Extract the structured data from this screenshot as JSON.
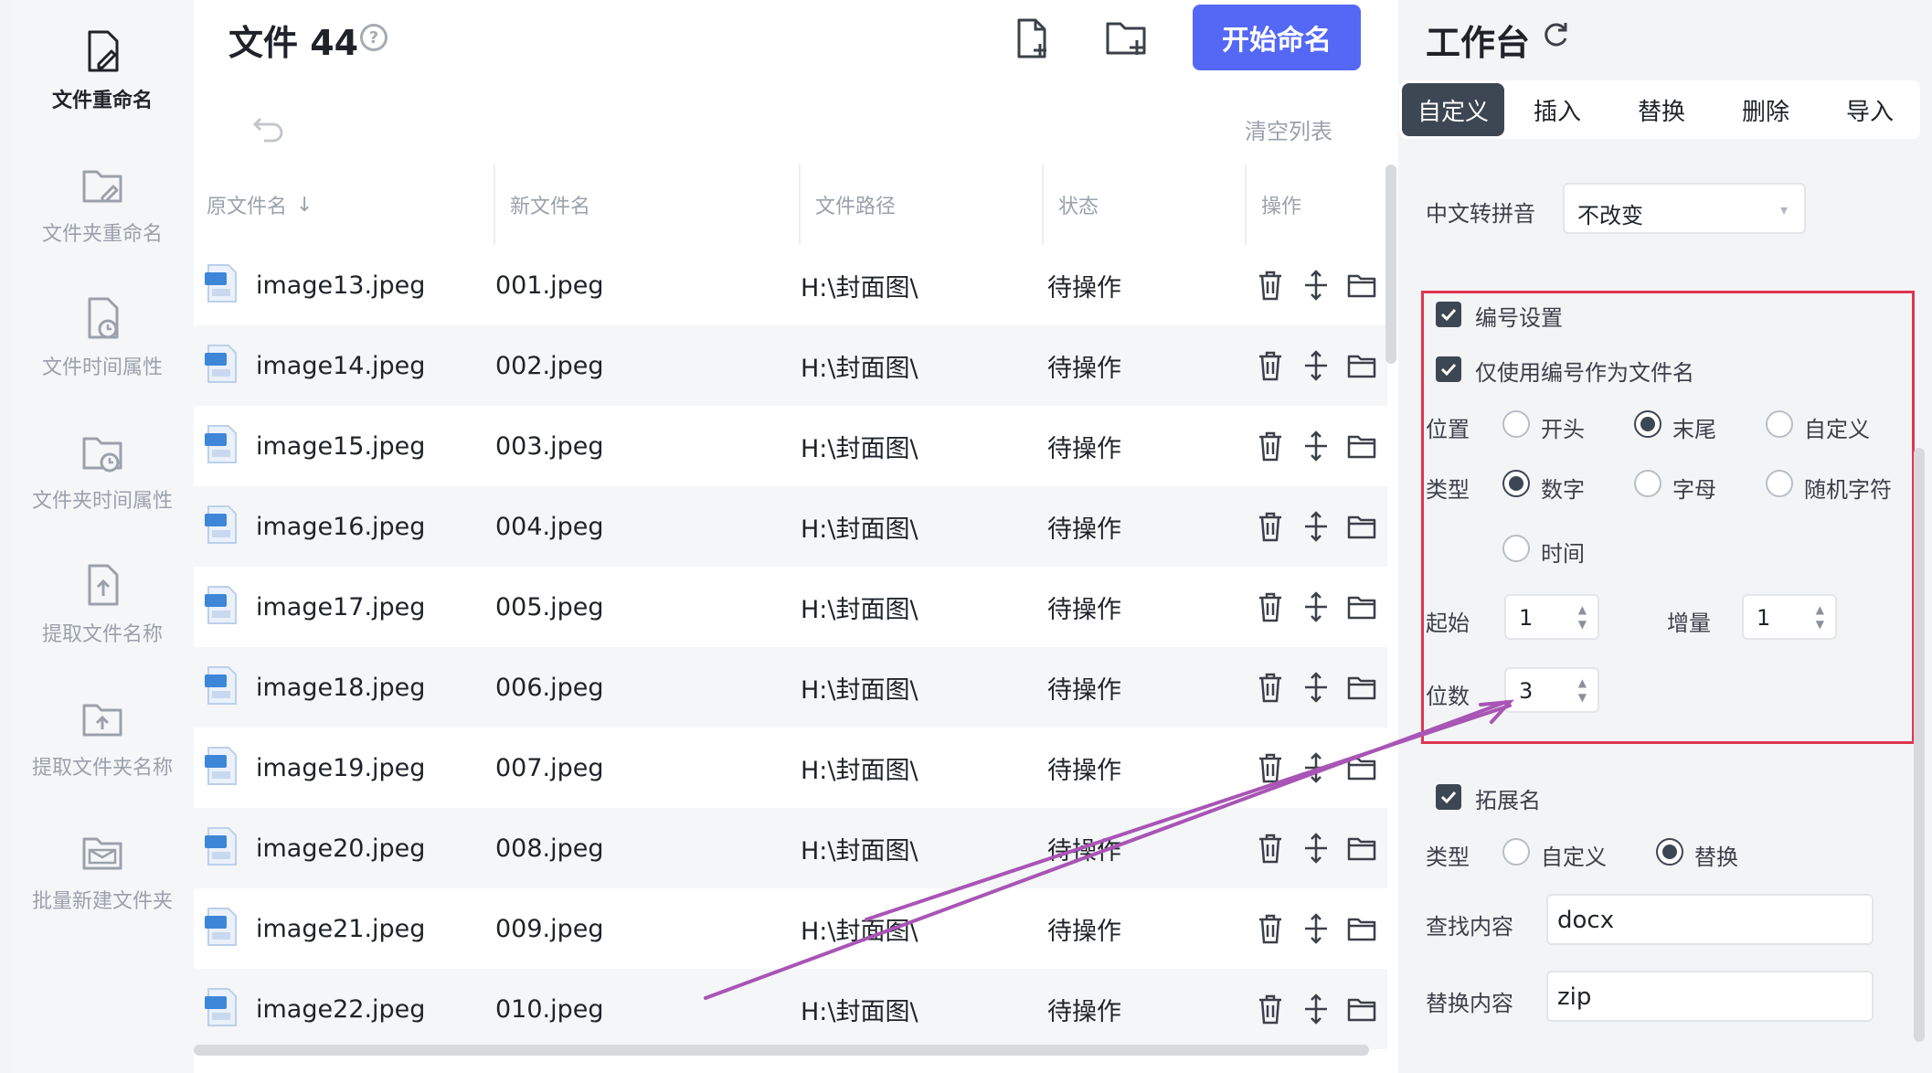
{
  "sidebar": {
    "items": [
      {
        "label": "文件重命名",
        "active": true,
        "icon": "file-edit-icon"
      },
      {
        "label": "文件夹重命名",
        "active": false,
        "icon": "folder-edit-icon"
      },
      {
        "label": "文件时间属性",
        "active": false,
        "icon": "file-clock-icon"
      },
      {
        "label": "文件夹时间属性",
        "active": false,
        "icon": "folder-clock-icon"
      },
      {
        "label": "提取文件名称",
        "active": false,
        "icon": "file-upload-icon"
      },
      {
        "label": "提取文件夹名称",
        "active": false,
        "icon": "folder-upload-icon"
      },
      {
        "label": "批量新建文件夹",
        "active": false,
        "icon": "folder-mail-icon"
      }
    ]
  },
  "header": {
    "title": "文件 44",
    "help_icon": "question-circle-icon",
    "start_label": "开始命名",
    "clear_label": "清空列表"
  },
  "table": {
    "columns": [
      "原文件名",
      "新文件名",
      "文件路径",
      "状态",
      "操作"
    ],
    "rows": [
      {
        "original": "image13.jpeg",
        "new": "001.jpeg",
        "path": "H:\\封面图\\",
        "status": "待操作"
      },
      {
        "original": "image14.jpeg",
        "new": "002.jpeg",
        "path": "H:\\封面图\\",
        "status": "待操作"
      },
      {
        "original": "image15.jpeg",
        "new": "003.jpeg",
        "path": "H:\\封面图\\",
        "status": "待操作"
      },
      {
        "original": "image16.jpeg",
        "new": "004.jpeg",
        "path": "H:\\封面图\\",
        "status": "待操作"
      },
      {
        "original": "image17.jpeg",
        "new": "005.jpeg",
        "path": "H:\\封面图\\",
        "status": "待操作"
      },
      {
        "original": "image18.jpeg",
        "new": "006.jpeg",
        "path": "H:\\封面图\\",
        "status": "待操作"
      },
      {
        "original": "image19.jpeg",
        "new": "007.jpeg",
        "path": "H:\\封面图\\",
        "status": "待操作"
      },
      {
        "original": "image20.jpeg",
        "new": "008.jpeg",
        "path": "H:\\封面图\\",
        "status": "待操作"
      },
      {
        "original": "image21.jpeg",
        "new": "009.jpeg",
        "path": "H:\\封面图\\",
        "status": "待操作"
      },
      {
        "original": "image22.jpeg",
        "new": "010.jpeg",
        "path": "H:\\封面图\\",
        "status": "待操作"
      }
    ]
  },
  "workbench": {
    "title": "工作台",
    "tabs": [
      "自定义",
      "插入",
      "替换",
      "删除",
      "导入"
    ],
    "active_tab": "自定义",
    "pinyin_label": "中文转拼音",
    "pinyin_value": "不改变",
    "numbering": {
      "enabled_label": "编号设置",
      "only_number_label": "仅使用编号作为文件名",
      "position_label": "位置",
      "position_options": [
        "开头",
        "末尾",
        "自定义"
      ],
      "position_selected": "末尾",
      "type_label": "类型",
      "type_options": [
        "数字",
        "字母",
        "随机字符",
        "时间"
      ],
      "type_selected": "数字",
      "start_label": "起始",
      "start_value": "1",
      "step_label": "增量",
      "step_value": "1",
      "digits_label": "位数",
      "digits_value": "3"
    },
    "extension": {
      "enabled_label": "拓展名",
      "type_label": "类型",
      "type_options": [
        "自定义",
        "替换"
      ],
      "type_selected": "替换",
      "find_label": "查找内容",
      "find_value": "docx",
      "replace_label": "替换内容",
      "replace_value": "zip"
    }
  },
  "colors": {
    "accent": "#5468f5",
    "annotation_box": "#e0364f",
    "annotation_arrow": "#a855b5",
    "tab_active": "#3d4653"
  }
}
